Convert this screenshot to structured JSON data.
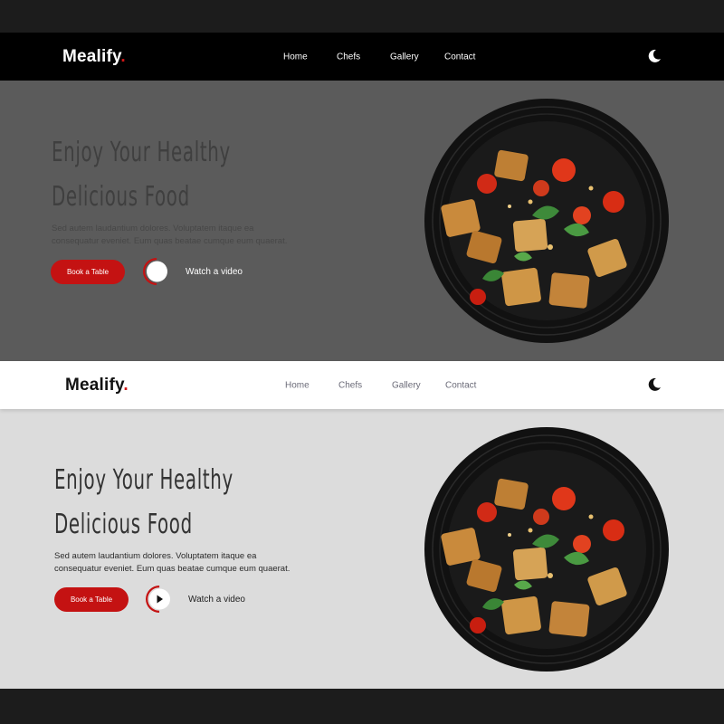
{
  "brand": {
    "name": "Mealify",
    "dot": ".",
    "accent": "#c41212"
  },
  "nav": {
    "items": [
      "Home",
      "Chefs",
      "Gallery",
      "Contact"
    ],
    "theme_toggle_icon": "moon-icon"
  },
  "hero": {
    "title_line1": "Enjoy Your Healthy",
    "title_line2": "Delicious Food",
    "desc_line1": "Sed autem laudantium dolores. Voluptatem itaque ea",
    "desc_line2": "consequatur eveniet. Eum quas beatae cumque eum quaerat.",
    "book_button": "Book a Table",
    "video_label": "Watch a video",
    "video_icon": "play-icon",
    "image": "food-bowl-image"
  },
  "themes": {
    "dark": {
      "nav_bg": "#000000",
      "body_bg": "#5b5b5b"
    },
    "light": {
      "nav_bg": "#ffffff",
      "body_bg": "#dcdcdc"
    }
  }
}
